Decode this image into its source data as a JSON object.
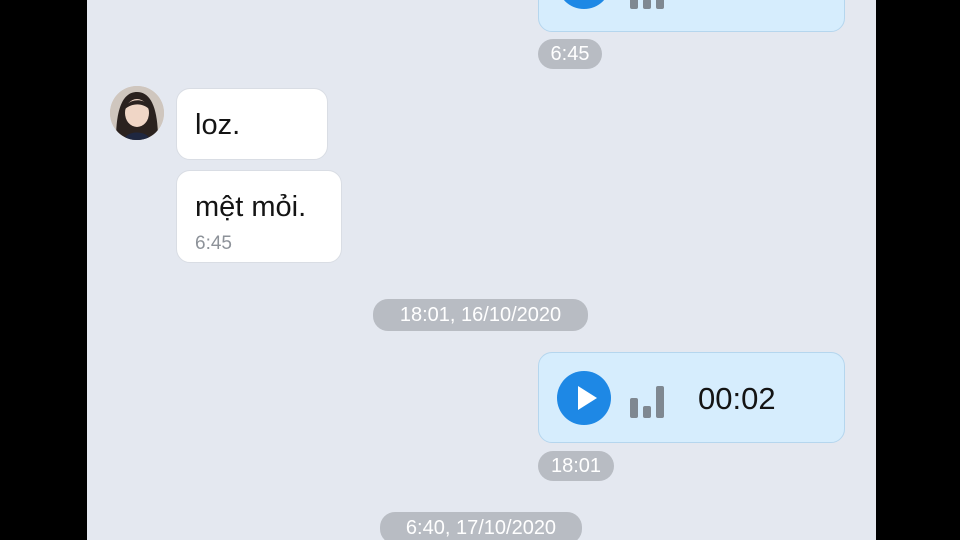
{
  "colors": {
    "chat_background": "#e4e8f0",
    "incoming_bubble": "#ffffff",
    "outgoing_bubble": "#d6edfd",
    "play_button": "#1e88e5",
    "pill_background": "#b8bcc3"
  },
  "messages": {
    "top_voice_time": "6:45",
    "incoming": {
      "first_text": "loz.",
      "second_text": "mệt mỏi.",
      "second_time": "6:45"
    },
    "date_separator_1": "18:01, 16/10/2020",
    "voice_message": {
      "duration": "00:02",
      "time": "18:01"
    },
    "date_separator_2": "6:40, 17/10/2020"
  },
  "icons": {
    "play": "play-icon",
    "waveform": "audio-waveform-icon",
    "avatar": "contact-avatar"
  }
}
